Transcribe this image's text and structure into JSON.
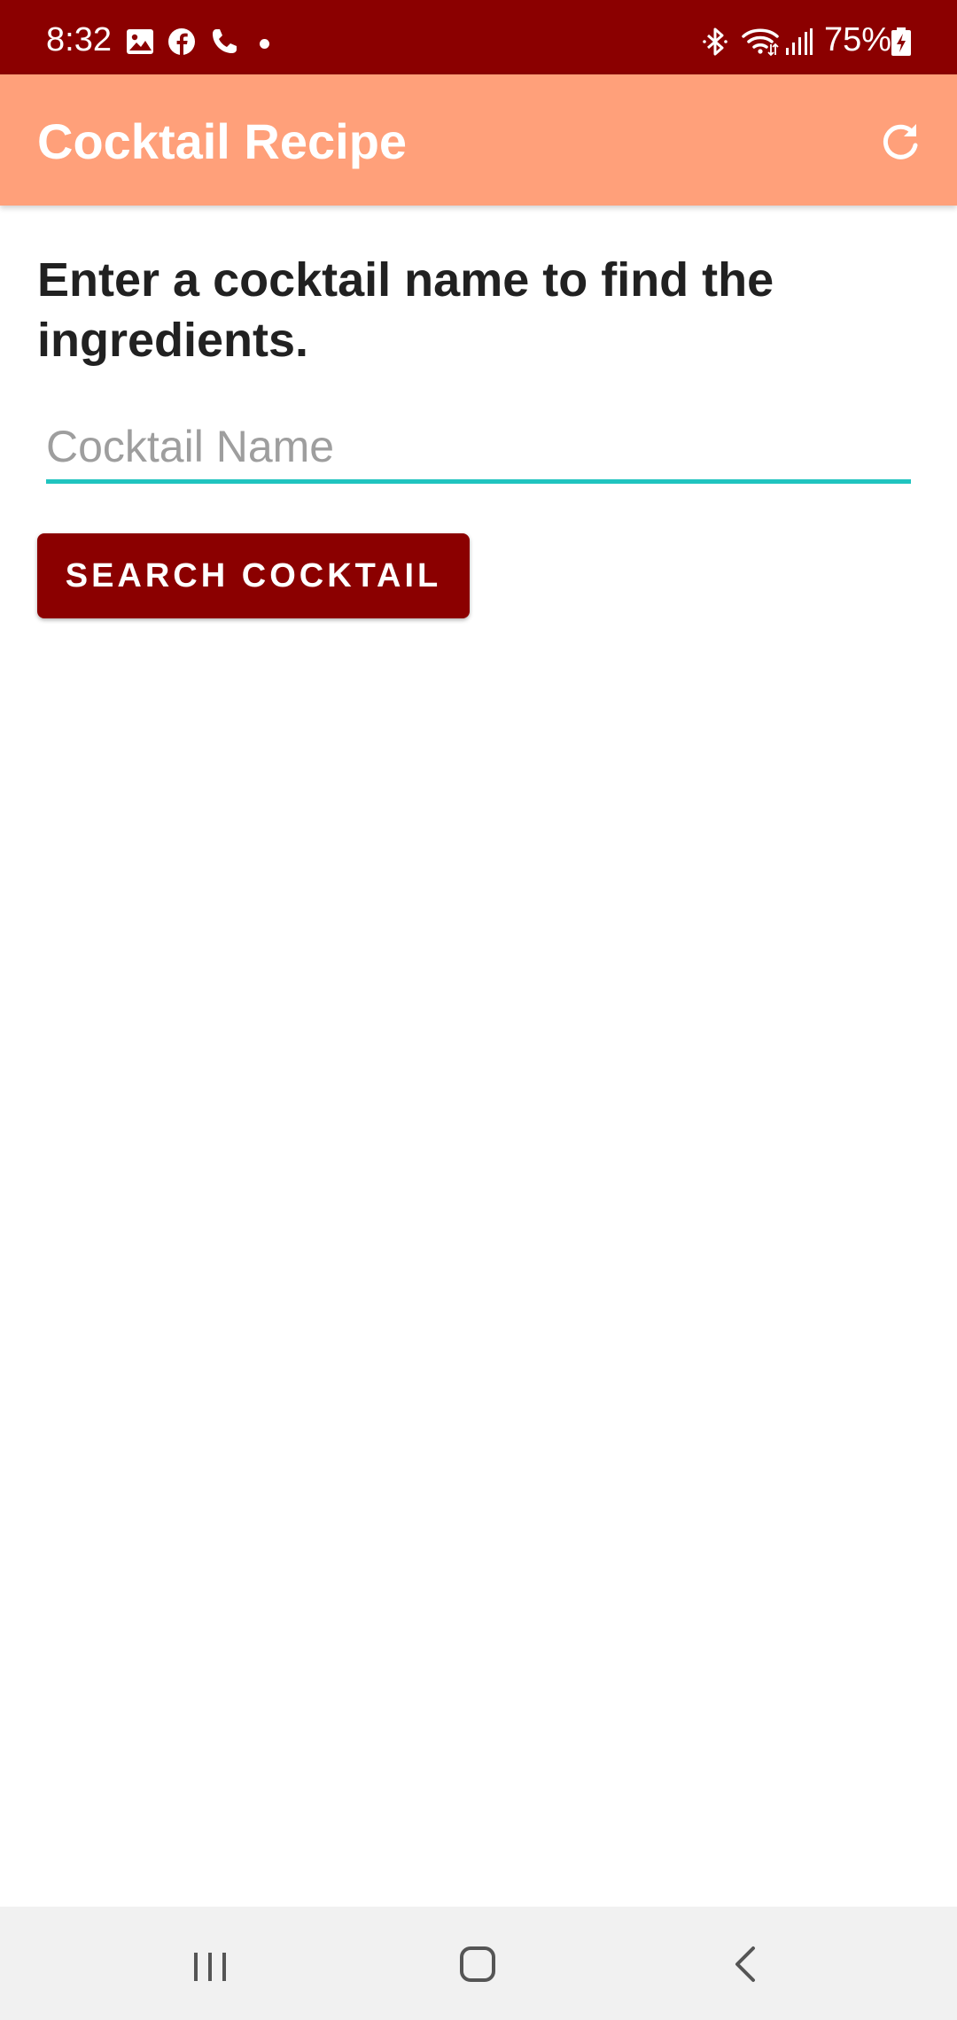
{
  "status_bar": {
    "time": "8:32",
    "battery": "75%",
    "left_icons": [
      "gallery-icon",
      "facebook-icon",
      "phone-icon"
    ],
    "right_icons": [
      "bluetooth-icon",
      "wifi-icon",
      "signal-icon",
      "battery-charging-icon"
    ]
  },
  "app_bar": {
    "title": "Cocktail Recipe",
    "action_icon": "refresh-icon"
  },
  "main": {
    "prompt": "Enter a cocktail name to find the ingredients.",
    "input": {
      "value": "",
      "placeholder": "Cocktail Name"
    },
    "search_button_label": "SEARCH COCKTAIL"
  },
  "nav_bar": {
    "items": [
      "recent-apps-icon",
      "home-icon",
      "back-icon"
    ]
  },
  "colors": {
    "status_bar": "#8b0000",
    "app_bar": "#ffa07a",
    "accent": "#20c4bf",
    "button": "#8b0000"
  }
}
